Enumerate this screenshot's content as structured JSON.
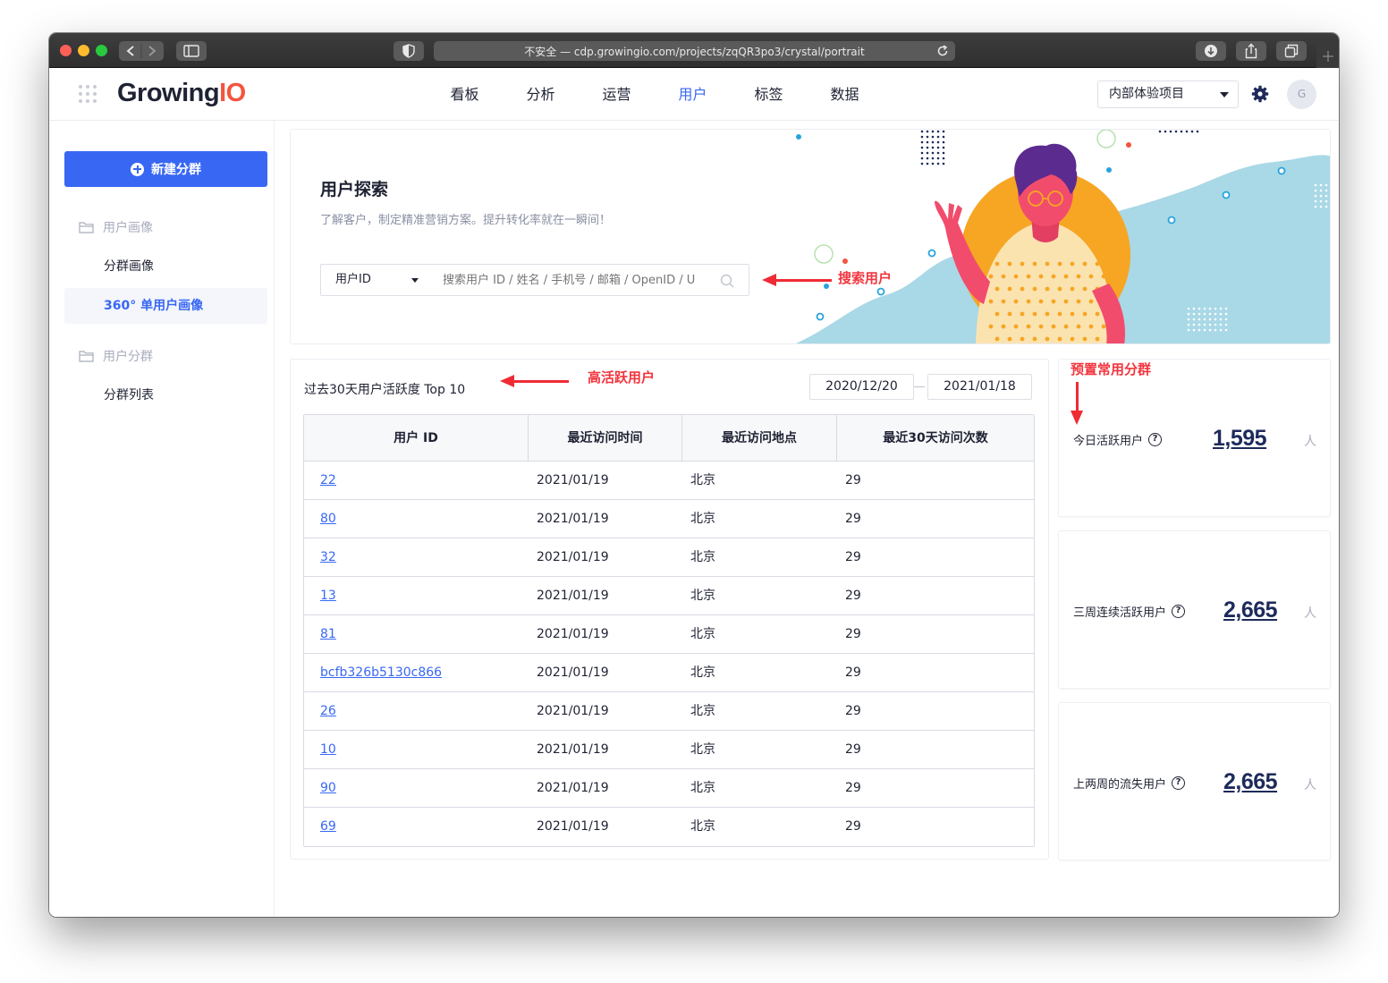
{
  "browser": {
    "url_text": "不安全 — cdp.growingio.com/projects/zqQR3po3/crystal/portrait"
  },
  "header": {
    "logo_main": "Growing",
    "logo_accent": "IO",
    "nav": [
      {
        "label": "看板",
        "active": false
      },
      {
        "label": "分析",
        "active": false
      },
      {
        "label": "运营",
        "active": false
      },
      {
        "label": "用户",
        "active": true
      },
      {
        "label": "标签",
        "active": false
      },
      {
        "label": "数据",
        "active": false
      }
    ],
    "project": "内部体验项目",
    "avatar_letter": "G",
    "accent_color": "#3867f4"
  },
  "sidebar": {
    "new_button": "新建分群",
    "group1_title": "用户画像",
    "group1_items": [
      "分群画像",
      "360° 单用户画像"
    ],
    "group2_title": "用户分群",
    "group2_items": [
      "分群列表"
    ]
  },
  "banner": {
    "title": "用户探索",
    "subtitle": "了解客户，制定精准营销方案。提升转化率就在一瞬间！",
    "search_type": "用户ID",
    "search_placeholder": "搜索用户 ID / 姓名 / 手机号 / 邮箱 / OpenID / U"
  },
  "annotations": {
    "search_user": "搜索用户",
    "high_active": "高活跃用户",
    "preset_groups": "预置常用分群",
    "color": "#f2343d"
  },
  "table_card": {
    "title": "过去30天用户活跃度 Top 10",
    "date_start": "2020/12/20",
    "date_end": "2021/01/18",
    "columns": [
      "用户 ID",
      "最近访问时间",
      "最近访问地点",
      "最近30天访问次数"
    ],
    "rows": [
      {
        "id": "22",
        "time": "2021/01/19",
        "place": "北京",
        "count": "29"
      },
      {
        "id": "80",
        "time": "2021/01/19",
        "place": "北京",
        "count": "29"
      },
      {
        "id": "32",
        "time": "2021/01/19",
        "place": "北京",
        "count": "29"
      },
      {
        "id": "13",
        "time": "2021/01/19",
        "place": "北京",
        "count": "29"
      },
      {
        "id": "81",
        "time": "2021/01/19",
        "place": "北京",
        "count": "29"
      },
      {
        "id": "bcfb326b5130c866",
        "time": "2021/01/19",
        "place": "北京",
        "count": "29"
      },
      {
        "id": "26",
        "time": "2021/01/19",
        "place": "北京",
        "count": "29"
      },
      {
        "id": "10",
        "time": "2021/01/19",
        "place": "北京",
        "count": "29"
      },
      {
        "id": "90",
        "time": "2021/01/19",
        "place": "北京",
        "count": "29"
      },
      {
        "id": "69",
        "time": "2021/01/19",
        "place": "北京",
        "count": "29"
      }
    ]
  },
  "stats": [
    {
      "label": "今日活跃用户",
      "value": "1,595",
      "unit": "人"
    },
    {
      "label": "三周连续活跃用户",
      "value": "2,665",
      "unit": "人"
    },
    {
      "label": "上两周的流失用户",
      "value": "2,665",
      "unit": "人"
    }
  ]
}
